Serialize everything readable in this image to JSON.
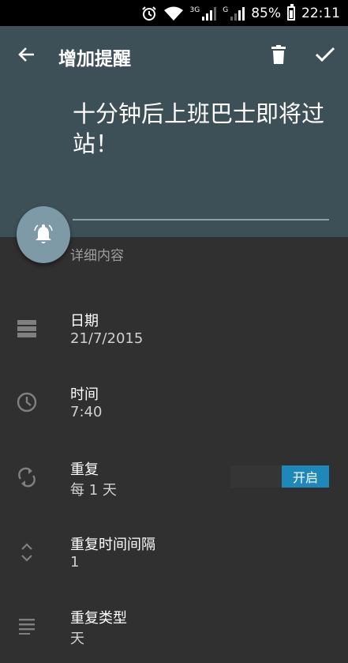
{
  "status_bar": {
    "network_3g": "3G",
    "network_g": "G",
    "battery": "85%",
    "time": "22:11",
    "icons": [
      "alarm-icon",
      "wifi-icon",
      "signal-icon",
      "battery-icon"
    ]
  },
  "toolbar": {
    "back_icon": "arrow-back-icon",
    "title": "增加提醒",
    "delete_icon": "trash-icon",
    "save_icon": "check-icon"
  },
  "reminder": {
    "title_text": "十分钟后上班巴士即将过站！",
    "detail_placeholder": "详细内容",
    "fab_icon": "bell-icon"
  },
  "fields": [
    {
      "icon": "calendar-icon",
      "label": "日期",
      "value": "21/7/2015"
    },
    {
      "icon": "clock-icon",
      "label": "时间",
      "value": "7:40"
    },
    {
      "icon": "repeat-icon",
      "label": "重复",
      "value": "每 1 天",
      "toggle": "开启"
    },
    {
      "icon": "unfold-icon",
      "label": "重复时间间隔",
      "value": "1"
    },
    {
      "icon": "list-icon",
      "label": "重复类型",
      "value": "天"
    }
  ],
  "colors": {
    "header": "#3d5058",
    "body": "#303030",
    "fab": "#7d9aa6",
    "toggle": "#1e88b8"
  }
}
